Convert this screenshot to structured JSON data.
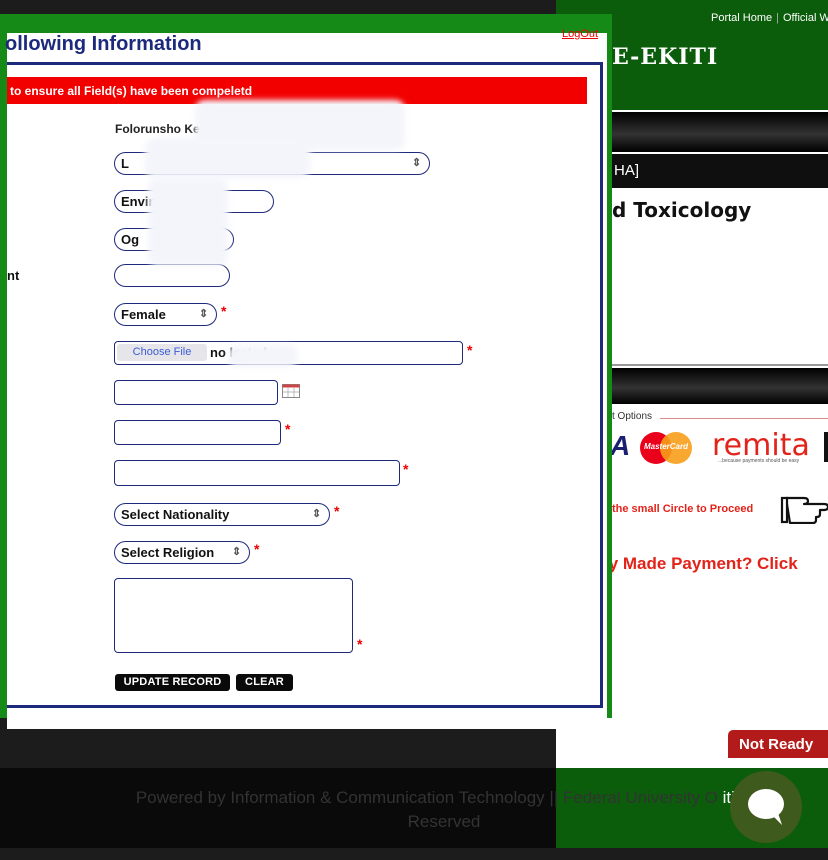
{
  "header": {
    "portal_home": "Portal Home",
    "official": "Official W",
    "site_name_fragment": "E-EKITI"
  },
  "background_page": {
    "department_fragment": "HA]",
    "course_title_fragment": "d Toxicology",
    "payment_options_label": "t Options",
    "mastercard_label": "MasterCard",
    "remita_label": "remita",
    "remita_tagline": "...because payments should be easy",
    "visa_fragment": "A",
    "proceed_text": "the small Circle to Proceed",
    "already_paid": "ly Made Payment? Click",
    "not_ready_button": "Not Ready"
  },
  "footer": {
    "line1": "Powered by Information & Communication Technology || Federal University O",
    "line1_end": "iti ©",
    "line2": "Reserved"
  },
  "modal": {
    "title": "ollowing Information",
    "logout": "LogOut",
    "alert": "to ensure all Field(s) have been compeletd",
    "side_label": "nt",
    "name_line": "Folorunsho Ke                           20",
    "fields": {
      "level_select_fragment": "L",
      "department_fragment": "Enviro       nan",
      "origin_fragment": "Og",
      "gender_value": "Female",
      "choose_file_label": "Choose File",
      "file_status": "no        lected",
      "nationality_placeholder": "Select Nationality",
      "religion_placeholder": "Select Religion"
    },
    "required_mark": "*",
    "buttons": {
      "update": "UPDATE RECORD",
      "clear": "CLEAR"
    }
  },
  "colors": {
    "header_green": "#0b5d0b",
    "modal_border_green": "#168a16",
    "alert_red": "#f20000",
    "navy": "#1d2a7c",
    "accent_red": "#e2231a",
    "not_ready_red": "#b31b1b"
  }
}
